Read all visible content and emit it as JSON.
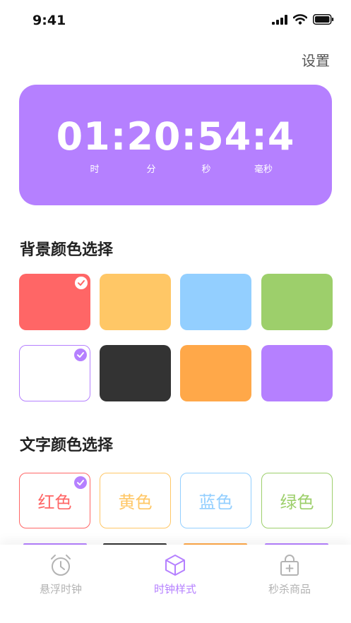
{
  "status_bar": {
    "time": "9:41"
  },
  "header": {
    "settings_label": "设置"
  },
  "clock": {
    "display": "01:20:54:4",
    "units": [
      "时",
      "分",
      "秒",
      "毫秒"
    ],
    "background_color": "#b580ff"
  },
  "background_section": {
    "title": "背景颜色选择",
    "swatches": [
      {
        "color": "#ff6666",
        "selected": true
      },
      {
        "color": "#ffc766",
        "selected": false
      },
      {
        "color": "#93cfff",
        "selected": false
      },
      {
        "color": "#9dcf6b",
        "selected": false
      },
      {
        "color": "#ffffff",
        "selected": true
      },
      {
        "color": "#333333",
        "selected": false
      },
      {
        "color": "#ffa849",
        "selected": false
      },
      {
        "color": "#b580ff",
        "selected": false
      }
    ]
  },
  "text_section": {
    "title": "文字颜色选择",
    "options": [
      {
        "label": "红色",
        "color": "#ff6666",
        "selected": true
      },
      {
        "label": "黄色",
        "color": "#ffc766",
        "selected": false
      },
      {
        "label": "蓝色",
        "color": "#93cfff",
        "selected": false
      },
      {
        "label": "绿色",
        "color": "#9dcf6b",
        "selected": false
      }
    ]
  },
  "tab_bar": {
    "active_color": "#b580ff",
    "inactive_color": "#b3b3b3",
    "tabs": [
      {
        "label": "悬浮时钟",
        "icon": "alarm-clock-icon",
        "active": false
      },
      {
        "label": "时钟样式",
        "icon": "cube-icon",
        "active": true
      },
      {
        "label": "秒杀商品",
        "icon": "shopping-bag-icon",
        "active": false
      }
    ]
  }
}
